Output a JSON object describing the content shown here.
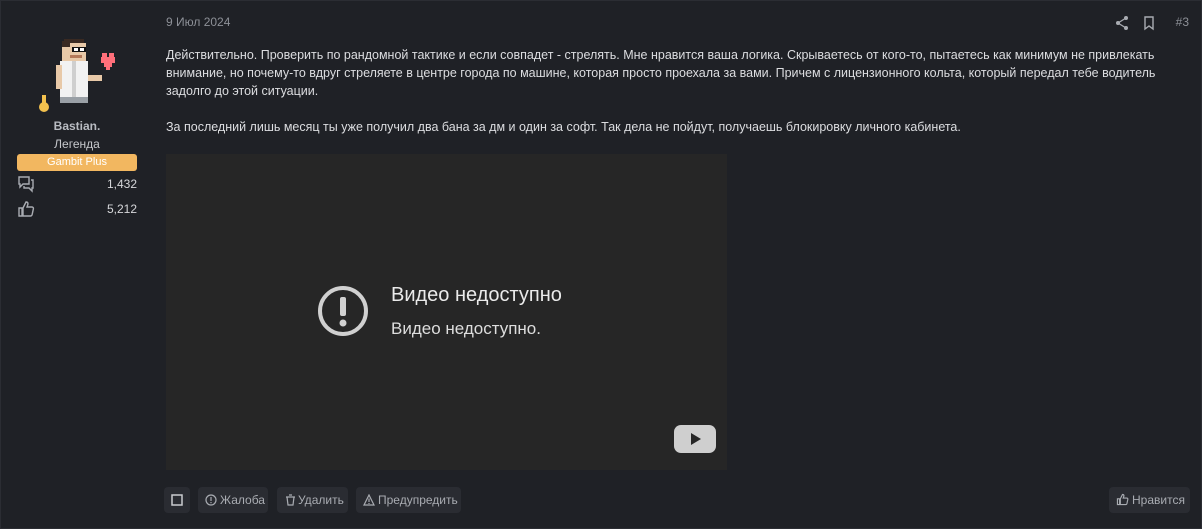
{
  "user": {
    "name": "Bastian.",
    "title": "Легенда",
    "banner": "Gambit Plus",
    "messages_count": "1,432",
    "reactions_count": "5,212"
  },
  "post": {
    "date": "9 Июл 2024",
    "number": "#3",
    "paragraphs": [
      "Действительно. Проверить по рандомной тактике и если совпадет - стрелять. Мне нравится ваша логика. Скрываетесь от кого-то, пытаетесь как минимум не привлекать внимание, но почему-то вдруг стреляете в центре города по машине, которая просто проехала за вами. Причем с лицензионного кольта, который передал тебе водитель задолго до этой ситуации.",
      "За последний лишь месяц ты уже получил два бана за дм и один за софт. Так дела не пойдут, получаешь блокировку личного кабинета."
    ]
  },
  "video": {
    "title": "Видео недоступно",
    "subtitle": "Видео недоступно."
  },
  "actions": {
    "report": "Жалоба",
    "delete": "Удалить",
    "warn": "Предупредить",
    "like": "Нравится"
  },
  "colors": {
    "background": "#1f2126",
    "banner": "#f2b760",
    "button": "#2a2c32"
  }
}
